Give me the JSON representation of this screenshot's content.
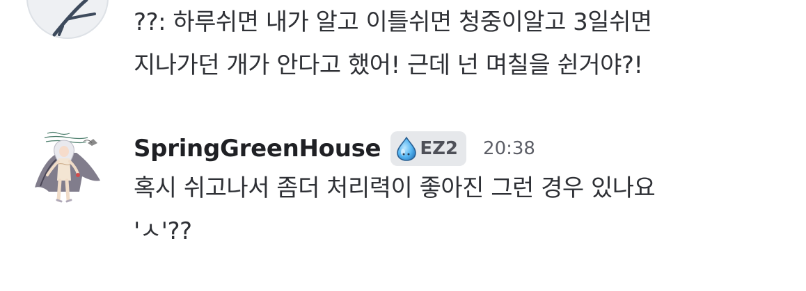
{
  "messages": [
    {
      "id": "msg-1",
      "avatar": "user-avatar-icon",
      "lines": [
        "??: 하루쉬면 내가 알고 이틀쉬면 청중이알고 3일쉬면",
        "지나가던 개가 안다고 했어! 근데 넌 며칠을 쉰거야?!"
      ]
    },
    {
      "id": "msg-2",
      "username": "SpringGreenHouse",
      "badge": {
        "icon": "water-drop-icon",
        "label": "EZ2"
      },
      "timestamp": "20:38",
      "lines": [
        "혹시 쉬고나서 좀더 처리력이 좋아진 그런 경우 있나요",
        "'ㅅ'??"
      ]
    }
  ]
}
